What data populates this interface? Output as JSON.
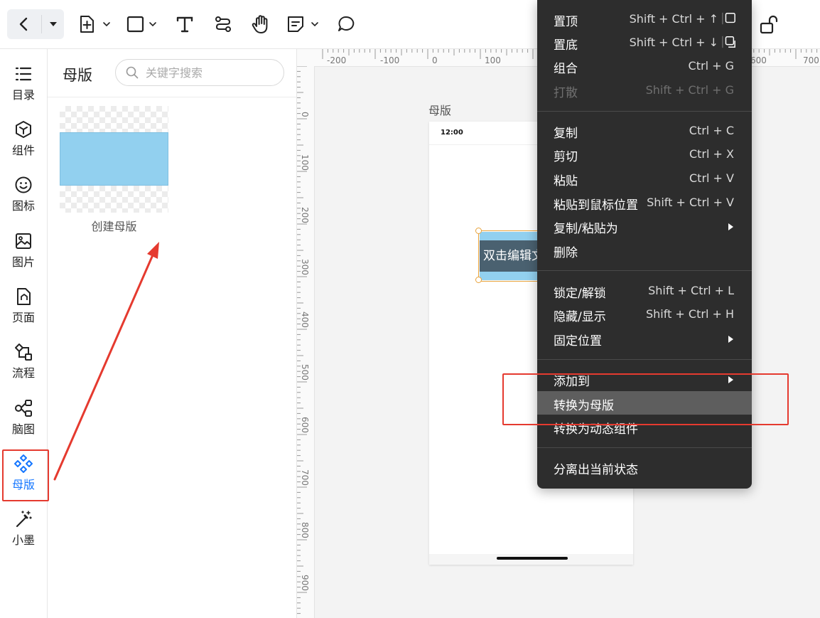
{
  "toolbar": {
    "back_icon": "chevron-left-icon",
    "dropdown_icon": "caret-down-icon",
    "tools": [
      "add-page-icon",
      "rectangle-icon",
      "text-icon",
      "connector-icon",
      "hand-icon",
      "note-icon",
      "comment-icon"
    ],
    "lock_icon": "unlock-icon"
  },
  "rail": {
    "items": [
      {
        "label": "目录",
        "icon": "list-icon"
      },
      {
        "label": "组件",
        "icon": "cube-icon"
      },
      {
        "label": "图标",
        "icon": "smiley-icon"
      },
      {
        "label": "图片",
        "icon": "image-icon"
      },
      {
        "label": "页面",
        "icon": "page-icon"
      },
      {
        "label": "流程",
        "icon": "flow-icon"
      },
      {
        "label": "脑图",
        "icon": "mindmap-icon"
      },
      {
        "label": "母版",
        "icon": "master-icon",
        "active": true
      },
      {
        "label": "小墨",
        "icon": "magic-wand-icon"
      }
    ]
  },
  "panel": {
    "title": "母版",
    "search_placeholder": "关键字搜索",
    "thumbnail_label": "创建母版"
  },
  "canvas": {
    "ruler_top": [
      "-200",
      "-100",
      "0",
      "100",
      "600",
      "700"
    ],
    "ruler_left": [
      "0",
      "100",
      "200",
      "300",
      "400",
      "500",
      "600",
      "700",
      "800",
      "900"
    ],
    "frame_title": "母版",
    "status_time": "12:00",
    "selected_text": "双击编辑文"
  },
  "context_menu": {
    "groups": [
      [
        {
          "label": "置顶",
          "shortcut": "Shift + Ctrl + ↑",
          "icon": "bring-to-front-icon"
        },
        {
          "label": "置底",
          "shortcut": "Shift + Ctrl + ↓",
          "icon": "send-to-back-icon"
        },
        {
          "label": "组合",
          "shortcut": "Ctrl + G"
        },
        {
          "label": "打散",
          "shortcut": "Shift + Ctrl + G",
          "disabled": true
        }
      ],
      [
        {
          "label": "复制",
          "shortcut": "Ctrl + C"
        },
        {
          "label": "剪切",
          "shortcut": "Ctrl + X"
        },
        {
          "label": "粘贴",
          "shortcut": "Ctrl + V"
        },
        {
          "label": "粘贴到鼠标位置",
          "shortcut": "Shift + Ctrl + V"
        },
        {
          "label": "复制/粘贴为",
          "submenu": true
        },
        {
          "label": "删除"
        }
      ],
      [
        {
          "label": "锁定/解锁",
          "shortcut": "Shift + Ctrl + L"
        },
        {
          "label": "隐藏/显示",
          "shortcut": "Shift + Ctrl + H"
        },
        {
          "label": "固定位置",
          "submenu": true
        }
      ],
      [
        {
          "label": "添加到",
          "submenu": true
        },
        {
          "label": "转换为母版",
          "hover": true
        },
        {
          "label": "转换为动态组件"
        }
      ],
      [
        {
          "label": "分离出当前状态"
        }
      ]
    ]
  },
  "colors": {
    "accent": "#1677ff",
    "annotation": "#e53a2f",
    "menu_bg": "#2d2d2d",
    "menu_hover": "#5e5e5e",
    "master_fill": "#92d0ef"
  }
}
